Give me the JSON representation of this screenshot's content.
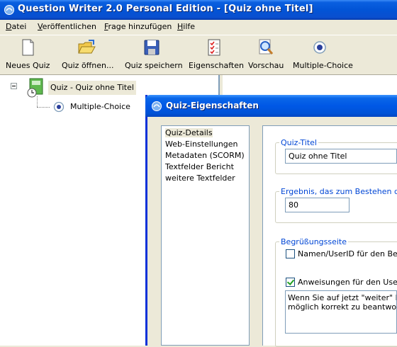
{
  "window": {
    "title": "Question Writer 2.0 Personal Edition - [Quiz ohne Titel]"
  },
  "menu": [
    {
      "pre": "",
      "u": "D",
      "post": "atei"
    },
    {
      "pre": "",
      "u": "V",
      "post": "eröffentlichen"
    },
    {
      "pre": "",
      "u": "F",
      "post": "rage hinzufügen"
    },
    {
      "pre": "",
      "u": "H",
      "post": "ilfe"
    }
  ],
  "toolbar": {
    "new_quiz": "Neues Quiz",
    "open_quiz": "Quiz öffnen...",
    "save_quiz": "Quiz speichern",
    "properties": "Eigenschaften",
    "preview": "Vorschau",
    "multiple_choice": "Multiple-Choice"
  },
  "tree": {
    "root_label": "Quiz - Quiz ohne Titel",
    "child_label": "Multiple-Choice"
  },
  "dialog": {
    "title": "Quiz-Eigenschaften",
    "nav": [
      "Quiz-Details",
      "Web-Einstellungen",
      "Metadaten (SCORM)",
      "Textfelder Bericht",
      "weitere Textfelder"
    ],
    "quiz_title_legend": "Quiz-Titel",
    "quiz_title_value": "Quiz ohne Titel",
    "pass_legend": "Ergebnis, das zum Bestehen der P",
    "pass_value": "80",
    "welcome_legend": "Begrüßungsseite",
    "name_checkbox_label": "Namen/UserID für den Berich",
    "name_checked": false,
    "instructions_checkbox_label": "Anweisungen für den User an",
    "instructions_checked": true,
    "instructions_line1": "Wenn Sie auf jetzt \"weiter\" klick",
    "instructions_line2": "möglich korrekt zu beantworten."
  }
}
